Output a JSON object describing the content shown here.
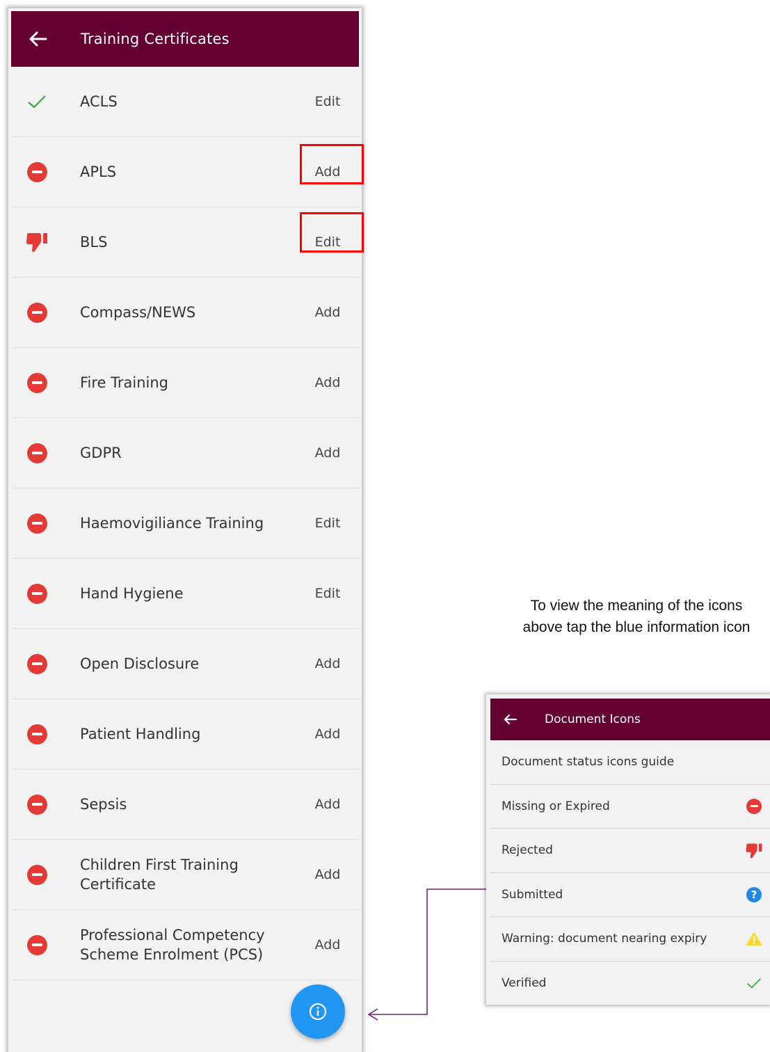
{
  "main": {
    "title": "Training Certificates",
    "items": [
      {
        "label": "ACLS",
        "action": "Edit",
        "status": "verified"
      },
      {
        "label": "APLS",
        "action": "Add",
        "status": "missing"
      },
      {
        "label": "BLS",
        "action": "Edit",
        "status": "rejected"
      },
      {
        "label": "Compass/NEWS",
        "action": "Add",
        "status": "missing"
      },
      {
        "label": "Fire Training",
        "action": "Add",
        "status": "missing"
      },
      {
        "label": "GDPR",
        "action": "Add",
        "status": "missing"
      },
      {
        "label": "Haemovigiliance Training",
        "action": "Edit",
        "status": "missing"
      },
      {
        "label": "Hand Hygiene",
        "action": "Edit",
        "status": "missing"
      },
      {
        "label": "Open Disclosure",
        "action": "Add",
        "status": "missing"
      },
      {
        "label": "Patient Handling",
        "action": "Add",
        "status": "missing"
      },
      {
        "label": "Sepsis",
        "action": "Add",
        "status": "missing"
      },
      {
        "label": "Children First Training Certificate",
        "action": "Add",
        "status": "missing"
      },
      {
        "label": "Professional Competency Scheme Enrolment (PCS)",
        "action": "Add",
        "status": "missing"
      }
    ],
    "fab_icon": "info-icon"
  },
  "caption": "To view the meaning of the icons above tap the blue information icon",
  "inset": {
    "title": "Document Icons",
    "rows": [
      {
        "label": "Document status icons guide",
        "icon": ""
      },
      {
        "label": "Missing or Expired",
        "icon": "minus-circle-icon"
      },
      {
        "label": "Rejected",
        "icon": "thumbs-down-icon"
      },
      {
        "label": "Submitted",
        "icon": "question-circle-icon"
      },
      {
        "label": "Warning: document nearing expiry",
        "icon": "warning-triangle-icon"
      },
      {
        "label": "Verified",
        "icon": "check-icon"
      }
    ]
  },
  "colors": {
    "appbar": "#640032",
    "missing": "#e53935",
    "verified": "#4caf50",
    "submitted": "#1e88e5",
    "warning": "#fdd835",
    "fab": "#2196f3",
    "highlight": "#ff0000",
    "connector": "#7a1f78"
  }
}
